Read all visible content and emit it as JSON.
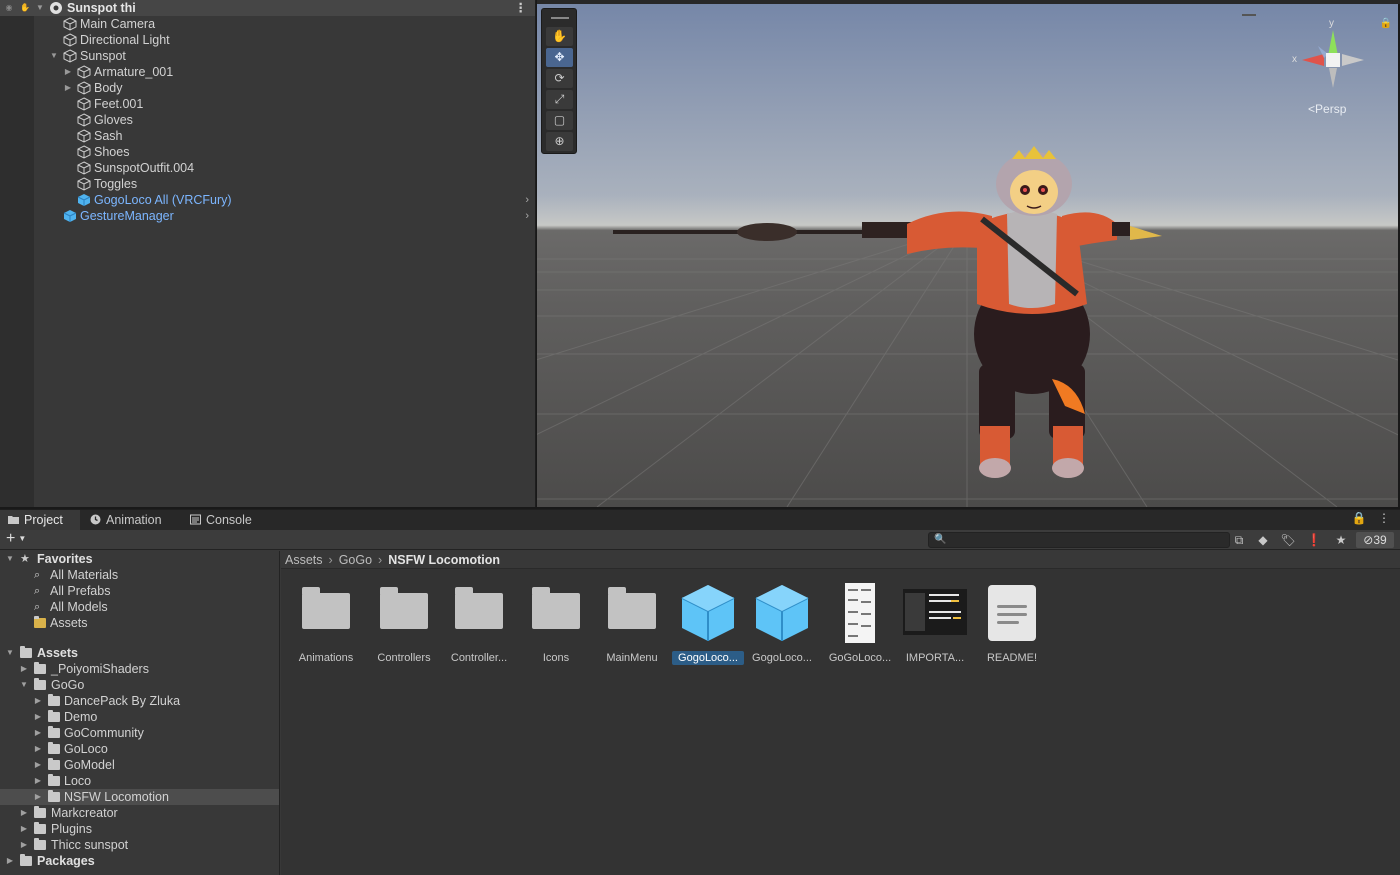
{
  "hierarchy": {
    "scene_name": "Sunspot thi",
    "items": [
      {
        "label": "Main Camera"
      },
      {
        "label": "Directional Light"
      },
      {
        "label": "Sunspot"
      },
      {
        "label": "Armature_001"
      },
      {
        "label": "Body"
      },
      {
        "label": "Feet.001"
      },
      {
        "label": "Gloves"
      },
      {
        "label": "Sash"
      },
      {
        "label": "Shoes"
      },
      {
        "label": "SunspotOutfit.004"
      },
      {
        "label": "Toggles"
      },
      {
        "label": "GogoLoco All (VRCFury)"
      },
      {
        "label": "GestureManager"
      }
    ]
  },
  "scene": {
    "projection": "Persp",
    "gizmo": {
      "x_label": "x",
      "y_label": "y"
    },
    "tools": [
      "hand-tool",
      "move-tool",
      "rotate-tool",
      "scale-tool",
      "rect-tool",
      "transform-tool"
    ],
    "active_tool": "move-tool"
  },
  "project": {
    "tabs": [
      {
        "label": "Project"
      },
      {
        "label": "Animation"
      },
      {
        "label": "Console"
      }
    ],
    "hidden_count": "39",
    "favorites": {
      "label": "Favorites",
      "items": [
        "All Materials",
        "All Prefabs",
        "All Models",
        "Assets"
      ]
    },
    "assets_tree": {
      "label": "Assets",
      "items": [
        {
          "label": "_PoiyomiShaders"
        },
        {
          "label": "GoGo"
        },
        {
          "label": "DancePack By Zluka"
        },
        {
          "label": "Demo"
        },
        {
          "label": "GoCommunity"
        },
        {
          "label": "GoLoco"
        },
        {
          "label": "GoModel"
        },
        {
          "label": "Loco"
        },
        {
          "label": "NSFW Locomotion"
        },
        {
          "label": "Markcreator"
        },
        {
          "label": "Plugins"
        },
        {
          "label": "Thicc sunspot"
        }
      ],
      "packages_label": "Packages"
    },
    "breadcrumb": [
      "Assets",
      "GoGo",
      "NSFW Locomotion"
    ],
    "grid": [
      {
        "label": "Animations",
        "type": "folder"
      },
      {
        "label": "Controllers",
        "type": "folder"
      },
      {
        "label": "Controller...",
        "type": "folder"
      },
      {
        "label": "Icons",
        "type": "folder"
      },
      {
        "label": "MainMenu",
        "type": "folder"
      },
      {
        "label": "GogoLoco...",
        "type": "prefab"
      },
      {
        "label": "GogoLoco...",
        "type": "prefab"
      },
      {
        "label": "GoGoLoco...",
        "type": "image"
      },
      {
        "label": "IMPORTA...",
        "type": "image"
      },
      {
        "label": "README!",
        "type": "document"
      }
    ]
  },
  "colors": {
    "accent": "#4a6690",
    "prefab_blue": "#7cb6ff",
    "selection": "#2c5d87"
  }
}
